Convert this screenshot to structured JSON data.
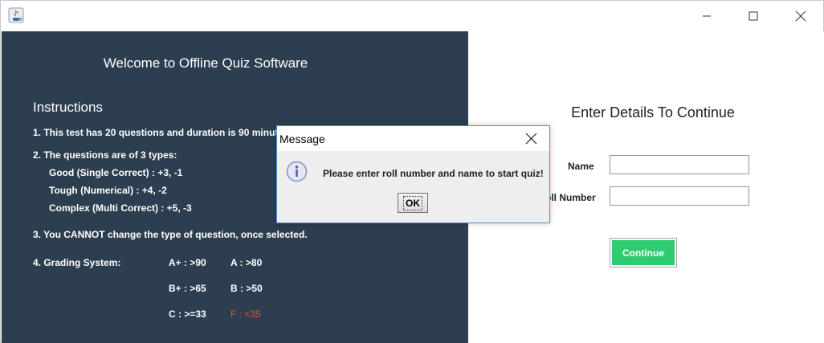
{
  "left": {
    "welcome": "Welcome to Offline Quiz Software",
    "instructions_heading": "Instructions",
    "rule1": "1. This test has 20 questions and duration is 90 minute",
    "rule2": "2. The questions are of 3 types:",
    "type_good": "Good (Single Correct) : +3, -1",
    "type_tough": "Tough (Numerical) : +4, -2",
    "type_complex": "Complex (Multi Correct) : +5, -3",
    "rule3": "3. You CANNOT change the type of question, once selected.",
    "rule4": "4. Grading System:",
    "grades": {
      "a_plus": "A+ : >90",
      "a": "A : >80",
      "b_plus": "B+ : >65",
      "b": "B : >50",
      "c": "C : >=33",
      "f": "F : <35"
    }
  },
  "right": {
    "title": "Enter Details To Continue",
    "name_label": "Name",
    "roll_label": "oll Number",
    "name_value": "",
    "roll_value": "",
    "continue_label": "Continue"
  },
  "dialog": {
    "title": "Message",
    "message": "Please enter roll number and name to start quiz!",
    "ok_label": "OK"
  },
  "colors": {
    "left_panel": "#2d3e50",
    "continue_button": "#2ecc71",
    "fail_grade": "#e74c3c"
  }
}
